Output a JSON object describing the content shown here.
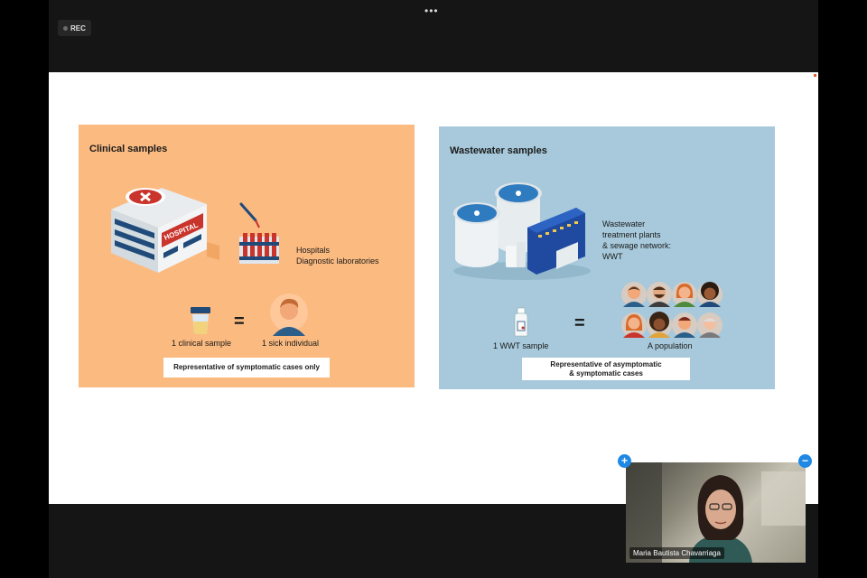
{
  "topbar": {
    "more_glyph": "•••",
    "rec_label": "REC"
  },
  "slide": {
    "clinical": {
      "title": "Clinical samples",
      "hospital_sign": "HOSPITAL",
      "sources": [
        "Hospitals",
        "Diagnostic laboratories"
      ],
      "sample_label": "1 clinical sample",
      "equals": "=",
      "individual_label": "1 sick individual",
      "callout": "Representative of symptomatic cases only"
    },
    "wastewater": {
      "title": "Wastewater samples",
      "sources": [
        "Wastewater",
        "treatment plants",
        "& sewage network:",
        "WWT"
      ],
      "sample_label": "1 WWT sample",
      "equals": "=",
      "population_label": "A population",
      "callout": [
        "Representative of asymptomatic",
        "& symptomatic cases"
      ]
    }
  },
  "video": {
    "participant_name": "Maria Bautista Chavarriaga",
    "add_glyph": "+",
    "remove_glyph": "−"
  },
  "colors": {
    "clinical_panel": "#fbba80",
    "wastewater_panel": "#a7c9db",
    "video_button": "#1e88e5"
  }
}
